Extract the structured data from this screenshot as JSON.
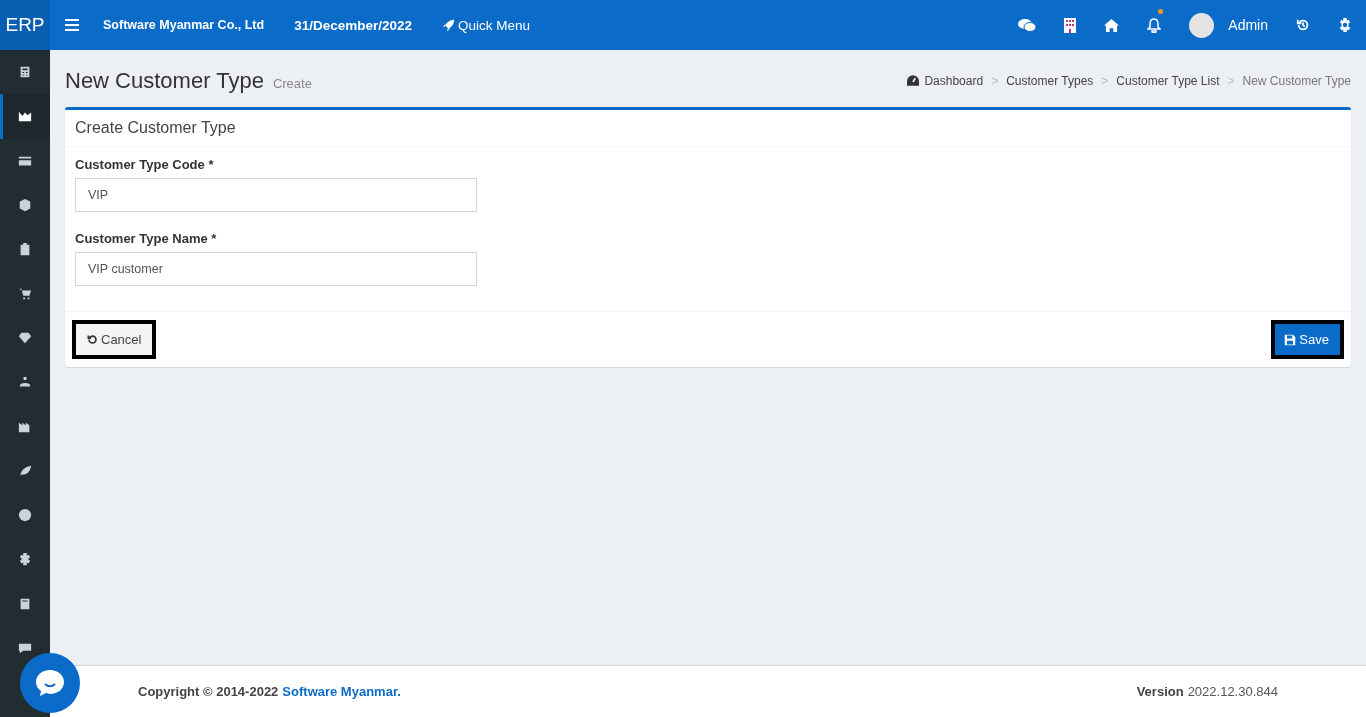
{
  "topbar": {
    "logo": "ERP",
    "company": "Software Myanmar Co., Ltd",
    "date": "31/December/2022",
    "quick_menu": "Quick Menu",
    "notification_dot": true,
    "user": "Admin"
  },
  "sidebar": {
    "items": [
      {
        "selected": false
      },
      {
        "selected": true
      },
      {
        "selected": false
      },
      {
        "selected": false
      },
      {
        "selected": false
      },
      {
        "selected": false
      },
      {
        "selected": false
      },
      {
        "selected": false
      },
      {
        "selected": false
      },
      {
        "selected": false
      },
      {
        "selected": false
      },
      {
        "selected": false
      },
      {
        "selected": false
      },
      {
        "selected": false
      }
    ]
  },
  "page": {
    "title": "New Customer Type",
    "subtitle": "Create",
    "breadcrumb_separator": ">",
    "breadcrumb": [
      {
        "label": "Dashboard",
        "current": false
      },
      {
        "label": "Customer Types",
        "current": false
      },
      {
        "label": "Customer Type List",
        "current": false
      },
      {
        "label": "New Customer Type",
        "current": true
      }
    ]
  },
  "card": {
    "title": "Create Customer Type",
    "fields": [
      {
        "label": "Customer Type Code *",
        "value": "VIP"
      },
      {
        "label": "Customer Type Name *",
        "value": "VIP customer"
      }
    ],
    "cancel": "Cancel",
    "save": "Save"
  },
  "footer": {
    "copyright": "Copyright © 2014-2022",
    "company_link": "Software Myanmar.",
    "version_label": "Version",
    "version": "2022.12.30.844"
  }
}
